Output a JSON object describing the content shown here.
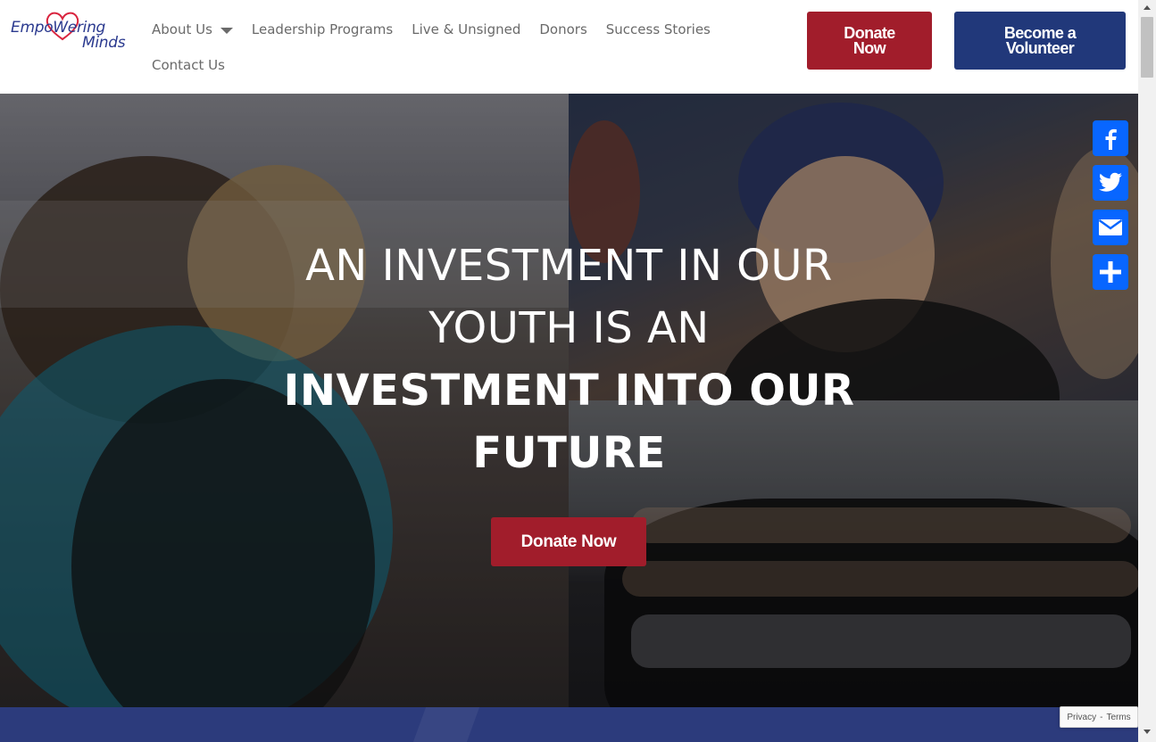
{
  "brand": {
    "logo_line1": "EmpoWering",
    "logo_line2": "Minds",
    "logo_icon": "heart-icon",
    "heart_color": "#d9253f",
    "text_color": "#2b3a8f"
  },
  "nav": {
    "items": [
      {
        "label": "About Us",
        "has_dropdown": true
      },
      {
        "label": "Leadership Programs",
        "has_dropdown": false
      },
      {
        "label": "Live & Unsigned",
        "has_dropdown": false
      },
      {
        "label": "Donors",
        "has_dropdown": false
      },
      {
        "label": "Success Stories",
        "has_dropdown": false
      },
      {
        "label": "Contact Us",
        "has_dropdown": false
      }
    ]
  },
  "header_buttons": {
    "donate_line1": "Donate",
    "donate_line2": "Now",
    "volunteer_line1": "Become a",
    "volunteer_line2": "Volunteer"
  },
  "hero": {
    "line1": "AN INVESTMENT IN OUR",
    "line2": "YOUTH IS AN",
    "line3": "INVESTMENT INTO OUR",
    "line4": "FUTURE",
    "cta_label": "Donate Now"
  },
  "share": {
    "buttons": [
      "facebook-icon",
      "twitter-icon",
      "email-icon",
      "share-plus-icon"
    ],
    "color": "#0866ff"
  },
  "recaptcha": {
    "privacy": "Privacy",
    "separator": "-",
    "terms": "Terms"
  },
  "colors": {
    "donate_red": "#a11d2b",
    "volunteer_blue": "#21387a",
    "band_blue": "#2c3b7c"
  }
}
